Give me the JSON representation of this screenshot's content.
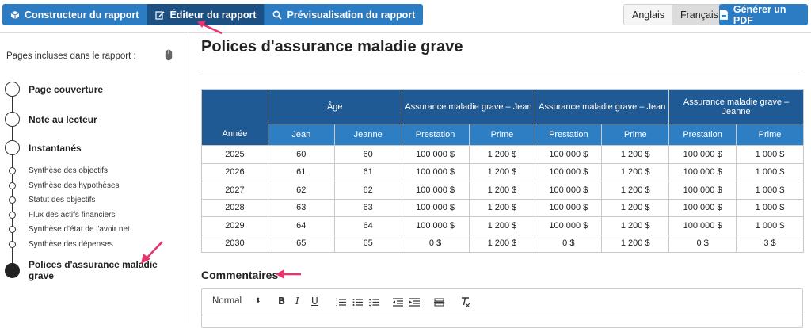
{
  "toolbar": {
    "tabs": [
      {
        "label": "Constructeur du rapport"
      },
      {
        "label": "Éditeur du rapport"
      },
      {
        "label": "Prévisualisation du rapport"
      }
    ],
    "languages": [
      {
        "label": "Anglais"
      },
      {
        "label": "Français"
      }
    ],
    "pdf_label": "Générer un PDF"
  },
  "sidebar": {
    "title": "Pages incluses dans le rapport :",
    "items": [
      {
        "label": "Page couverture"
      },
      {
        "label": "Note au lecteur"
      },
      {
        "label": "Instantanés"
      },
      {
        "label": "Synthèse des objectifs"
      },
      {
        "label": "Synthèse des hypothèses"
      },
      {
        "label": "Statut des objectifs"
      },
      {
        "label": "Flux des actifs financiers"
      },
      {
        "label": "Synthèse d'état de l'avoir net"
      },
      {
        "label": "Synthèse des dépenses"
      },
      {
        "label": "Polices d'assurance maladie grave"
      }
    ]
  },
  "main": {
    "title": "Polices d'assurance maladie grave",
    "table": {
      "col_annee": "Année",
      "group_age": "Âge",
      "group_jean": "Assurance maladie grave – Jean",
      "group_jean2": "Assurance maladie grave – Jean",
      "group_jeanne": "Assurance maladie grave – Jeanne",
      "sub_jean": "Jean",
      "sub_jeanne": "Jeanne",
      "sub_prestation": "Prestation",
      "sub_prime": "Prime",
      "rows": [
        [
          "2025",
          "60",
          "60",
          "100 000 $",
          "1 200 $",
          "100 000 $",
          "1 200 $",
          "100 000 $",
          "1 000 $"
        ],
        [
          "2026",
          "61",
          "61",
          "100 000 $",
          "1 200 $",
          "100 000 $",
          "1 200 $",
          "100 000 $",
          "1 000 $"
        ],
        [
          "2027",
          "62",
          "62",
          "100 000 $",
          "1 200 $",
          "100 000 $",
          "1 200 $",
          "100 000 $",
          "1 000 $"
        ],
        [
          "2028",
          "63",
          "63",
          "100 000 $",
          "1 200 $",
          "100 000 $",
          "1 200 $",
          "100 000 $",
          "1 000 $"
        ],
        [
          "2029",
          "64",
          "64",
          "100 000 $",
          "1 200 $",
          "100 000 $",
          "1 200 $",
          "100 000 $",
          "1 000 $"
        ],
        [
          "2030",
          "65",
          "65",
          "0 $",
          "1 200 $",
          "0 $",
          "1 200 $",
          "0 $",
          "3 $"
        ]
      ]
    },
    "comments_title": "Commentaires",
    "editor": {
      "format_label": "Normal",
      "bold": "B",
      "italic": "I",
      "underline": "U"
    }
  },
  "colors": {
    "primary": "#2c7cc4",
    "active_tab": "#1c4f82",
    "table_header_dark": "#1f5a95",
    "table_header_light": "#2e7ec4",
    "annotation_arrow": "#e8336d"
  }
}
